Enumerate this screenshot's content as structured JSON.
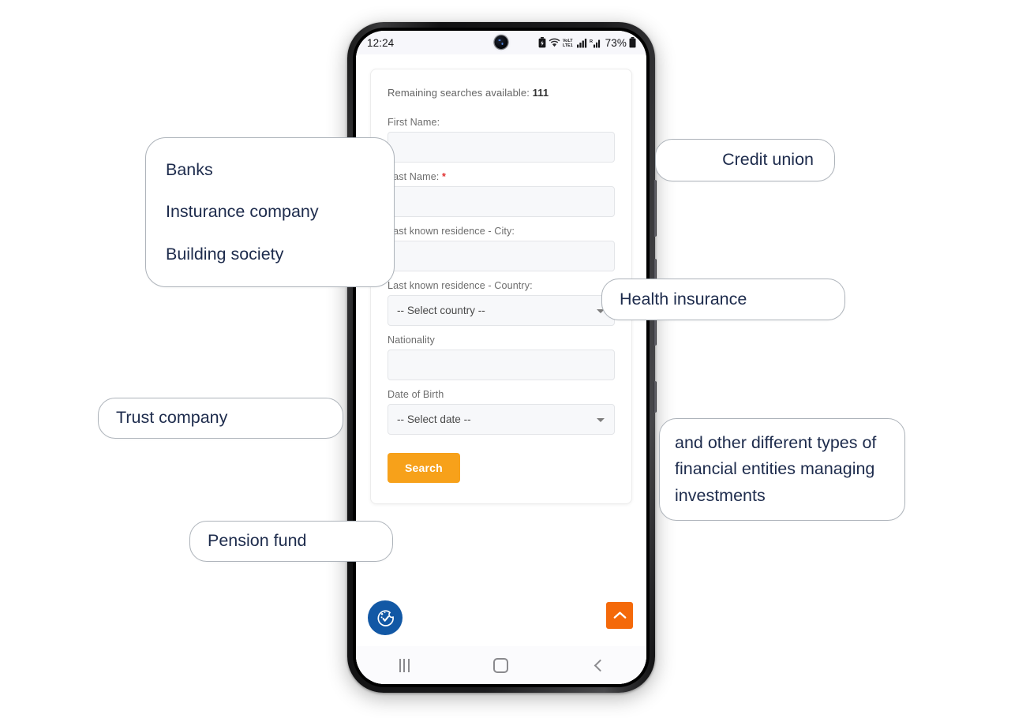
{
  "phone": {
    "status_bar": {
      "time": "12:24",
      "battery_percent": "73%",
      "icons": [
        "battery-saver-icon",
        "wifi-icon",
        "volte-icon",
        "signal-bars-icon",
        "signal-bars-2-icon",
        "battery-icon"
      ]
    },
    "nav_bar": {
      "recents_label": "recents-icon",
      "home_label": "home-icon",
      "back_label": "back-icon"
    }
  },
  "form": {
    "remaining_label": "Remaining searches available:",
    "remaining_count": "111",
    "fields": [
      {
        "label": "First Name:",
        "required": "",
        "type": "text",
        "value": ""
      },
      {
        "label": "Last Name:",
        "required": "*",
        "type": "text",
        "value": ""
      },
      {
        "label": "Last known residence - City:",
        "required": "",
        "type": "text",
        "value": ""
      },
      {
        "label": "Last known residence - Country:",
        "required": "",
        "type": "select",
        "value": "-- Select country --"
      },
      {
        "label": "Nationality",
        "required": "",
        "type": "text",
        "value": ""
      },
      {
        "label": "Date of Birth",
        "required": "",
        "type": "select",
        "value": "-- Select date --"
      }
    ],
    "search_button": "Search",
    "accent_orange": "#f7a11a",
    "required_red": "#e03131"
  },
  "widgets": {
    "cookie_badge": "cookie-consent-icon",
    "scroll_top": "scroll-to-top-icon",
    "scroll_top_color": "#f4690a",
    "cookie_badge_color": "#1258a5"
  },
  "callouts": {
    "left_list": {
      "lines": [
        "Banks",
        "Insturance company",
        "Building society"
      ]
    },
    "credit_union": "Credit union",
    "health_insurance": "Health insurance",
    "financial_entities": "and other different types of financial entities managing investments",
    "trust_company": "Trust company",
    "pension_fund": "Pension fund",
    "text_color": "#1d2b4c",
    "border_color": "#adb3ba"
  }
}
